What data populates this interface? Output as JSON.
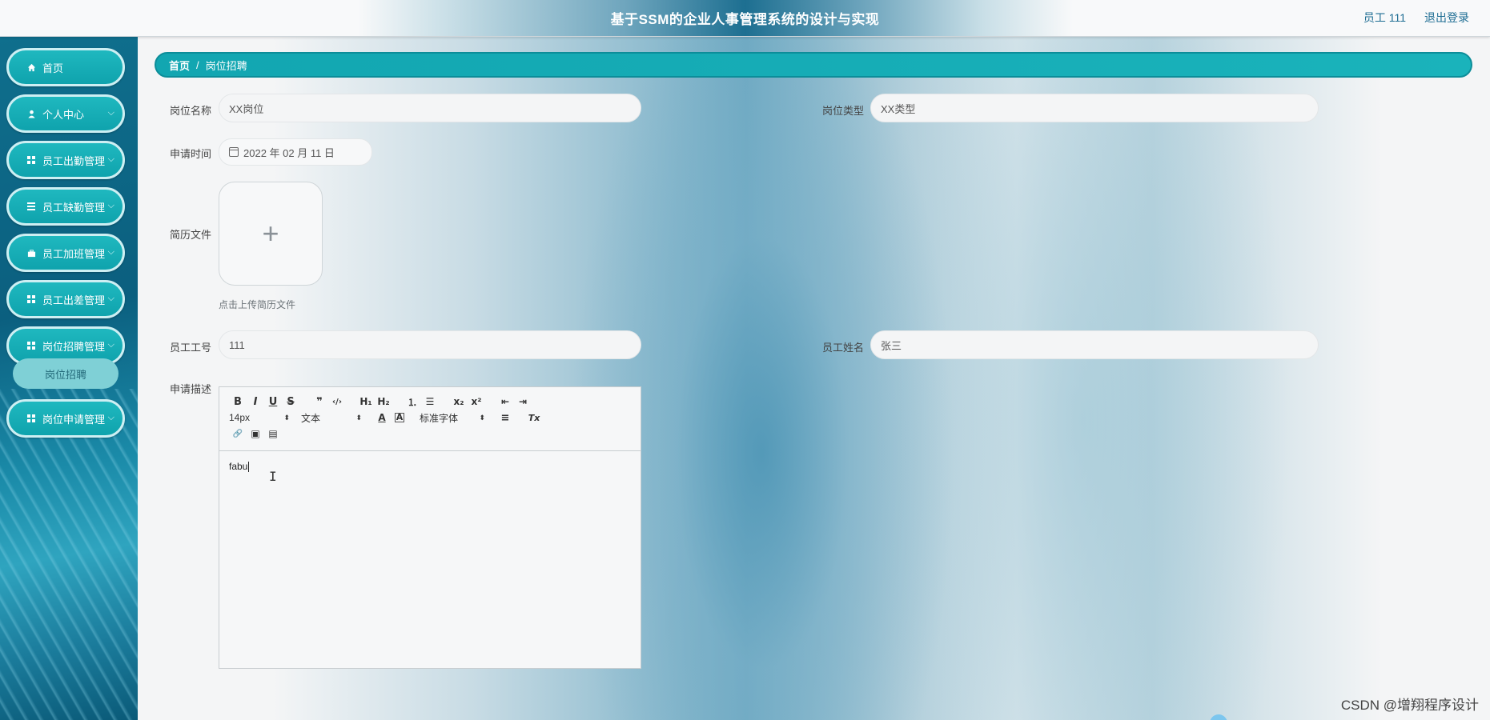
{
  "header": {
    "title": "基于SSM的企业人事管理系统的设计与实现",
    "user_label": "员工 111",
    "logout_label": "退出登录"
  },
  "sidebar": {
    "items": [
      {
        "label": "首页",
        "icon": "home-icon"
      },
      {
        "label": "个人中心",
        "icon": "user-icon"
      },
      {
        "label": "员工出勤管理",
        "icon": "grid-icon"
      },
      {
        "label": "员工缺勤管理",
        "icon": "list-icon"
      },
      {
        "label": "员工加班管理",
        "icon": "briefcase-icon"
      },
      {
        "label": "员工出差管理",
        "icon": "grid-icon"
      },
      {
        "label": "岗位招聘管理",
        "icon": "grid-icon"
      },
      {
        "label": "岗位申请管理",
        "icon": "grid-icon"
      }
    ],
    "submenu": {
      "label": "岗位招聘"
    }
  },
  "breadcrumb": {
    "home": "首页",
    "separator": "/",
    "current": "岗位招聘"
  },
  "form": {
    "job_name": {
      "label": "岗位名称",
      "value": "XX岗位"
    },
    "job_type": {
      "label": "岗位类型",
      "value": "XX类型"
    },
    "apply_time": {
      "label": "申请时间",
      "value": "2022 年 02 月 11 日"
    },
    "resume": {
      "label": "简历文件",
      "hint": "点击上传简历文件",
      "plus": "+"
    },
    "employee_id": {
      "label": "员工工号",
      "value": "111"
    },
    "employee_name": {
      "label": "员工姓名",
      "value": "张三"
    },
    "description": {
      "label": "申请描述",
      "content": "fabu"
    }
  },
  "editor": {
    "font_size": "14px",
    "text_style": "文本",
    "font_family": "标准字体",
    "buttons": {
      "bold": "B",
      "italic": "I",
      "underline": "U",
      "strike": "S",
      "quote": "❞",
      "code": "‹/›",
      "h1": "H₁",
      "h2": "H₂",
      "ordered_list": "⒈",
      "bullet_list": "☰",
      "subscript": "x₂",
      "superscript": "x²",
      "outdent": "⇤",
      "indent": "⇥",
      "color": "A",
      "background": "A",
      "align": "≡",
      "clear": "Tx",
      "link": "🔗",
      "image": "▣",
      "video": "▤"
    }
  },
  "watermark": "CSDN @增翔程序设计"
}
